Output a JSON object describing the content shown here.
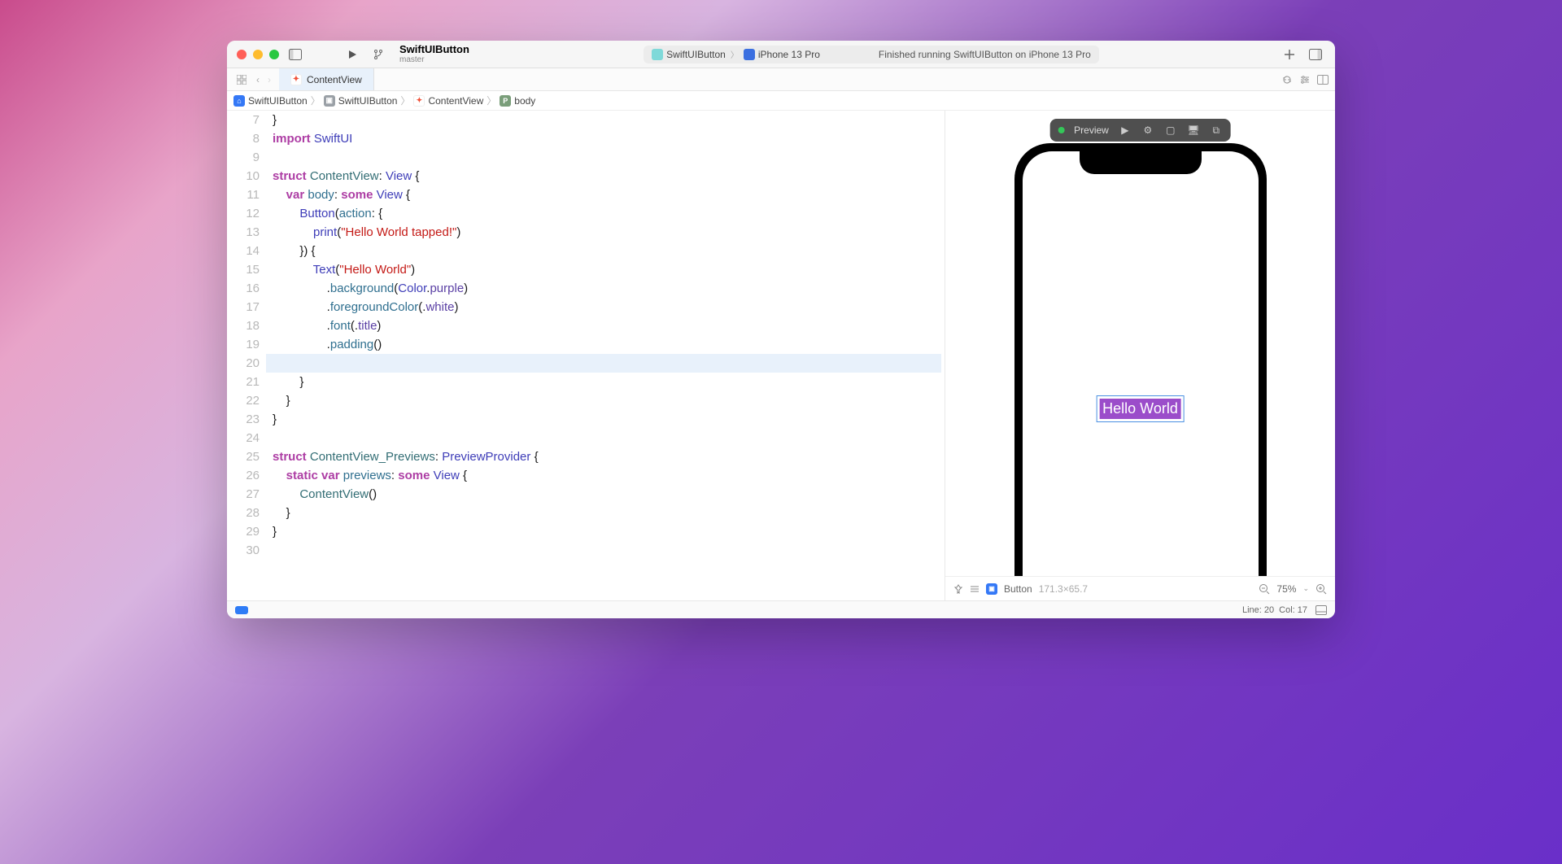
{
  "titlebar": {
    "project_name": "SwiftUIButton",
    "branch": "master",
    "scheme_target": "SwiftUIButton",
    "scheme_device": "iPhone 13 Pro",
    "status": "Finished running SwiftUIButton on iPhone 13 Pro"
  },
  "tab": {
    "filename": "ContentView"
  },
  "breadcrumb": {
    "items": [
      "SwiftUIButton",
      "SwiftUIButton",
      "ContentView",
      "body"
    ]
  },
  "code": {
    "lines_start": 7,
    "lines": [
      "}",
      "import SwiftUI",
      "",
      "struct ContentView: View {",
      "    var body: some View {",
      "        Button(action: {",
      "            print(\"Hello World tapped!\")",
      "        }) {",
      "            Text(\"Hello World\")",
      "                .background(Color.purple)",
      "                .foregroundColor(.white)",
      "                .font(.title)",
      "                .padding()",
      "",
      "        }",
      "    }",
      "}",
      "",
      "struct ContentView_Previews: PreviewProvider {",
      "    static var previews: some View {",
      "        ContentView()",
      "    }",
      "}",
      ""
    ],
    "highlighted_line": 20
  },
  "preview": {
    "toolbar_label": "Preview",
    "sample_button_text": "Hello World",
    "selected_element": "Button",
    "selected_size": "171.3×65.7",
    "zoom": "75%"
  },
  "statusbar": {
    "line": "Line: 20",
    "col": "Col: 17"
  }
}
